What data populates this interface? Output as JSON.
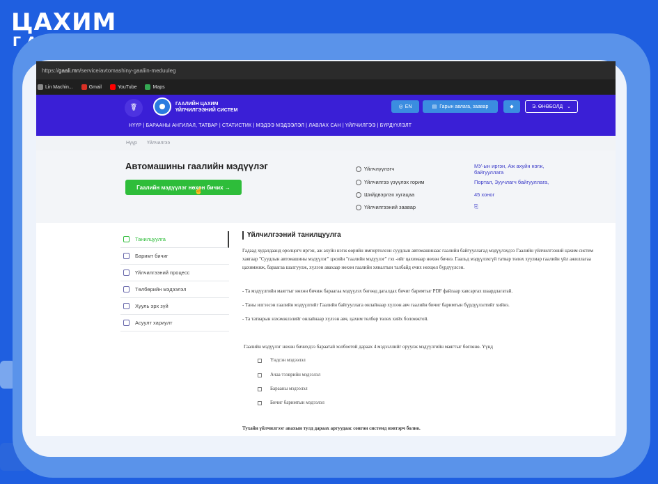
{
  "brand": {
    "line1": "ЦАХИМ",
    "line2": "ГААЛЬ"
  },
  "browser": {
    "url_prefix": "https://",
    "url_host": "gaali.mn",
    "url_path": "/service/avtomashiny-gaaliin-meduuleg",
    "bookmarks": [
      {
        "label": "Lin Machin...",
        "icon": "bookmark-icon",
        "color": "#8a8a8a"
      },
      {
        "label": "Gmail",
        "icon": "gmail-icon",
        "color": "#d93025"
      },
      {
        "label": "YouTube",
        "icon": "youtube-icon",
        "color": "#ff0000"
      },
      {
        "label": "Maps",
        "icon": "maps-icon",
        "color": "#34a853"
      }
    ]
  },
  "header": {
    "logo_text_1": "ГААЛИЙН ЦАХИМ",
    "logo_text_2": "ҮЙЛЧИЛГЭЭНИЙ СИСТЕМ",
    "lang_label": "EN",
    "guide_label": "Гарын авлага, заавар",
    "user_label": "Э. ӨНӨБОЛД",
    "nav": "НҮҮР | БАРААНЫ АНГИЛАЛ, ТАТВАР | СТАТИСТИК | МЭДЭЭ МЭДЭЭЛЭЛ | ЛАВЛАХ САН | ҮЙЛЧИЛГЭЭ | БҮРДҮҮЛЭЛТ"
  },
  "breadcrumb": {
    "home": "Нүүр",
    "current": "Үйлчилгээ"
  },
  "service": {
    "title": "Автомашины гаалийн мэдүүлэг",
    "apply_label": "Гаалийн мэдүүлэг нөхөн бичих  →",
    "info": [
      {
        "label": "Үйлчлүүлэгч",
        "value": "МУ-ын иргэн, Аж ахуйн нэгж, байгууллага"
      },
      {
        "label": "Үйлчилгээ үзүүлэх горим",
        "value": "Портал, Зуучлагч байгууллага,"
      },
      {
        "label": "Шийдвэрлэх хугацаа",
        "value": "45 хоног"
      },
      {
        "label": "Үйлчилгээний заавар",
        "value": "⎘"
      }
    ]
  },
  "sidebar": {
    "items": [
      {
        "label": "Танилцуулга",
        "active": true
      },
      {
        "label": "Баримт бичиг",
        "active": false
      },
      {
        "label": "Үйлчилгээний процесс",
        "active": false
      },
      {
        "label": "Төлбөрийн мэдээлэл",
        "active": false
      },
      {
        "label": "Хууль эрх зүй",
        "active": false
      },
      {
        "label": "Асуулт хариулт",
        "active": false
      }
    ]
  },
  "content": {
    "heading": "Үйлчилгээний танилцуулга",
    "paragraph": "Гадаад худалдаанд оролцогч иргэн, аж ахуйн нэгж өөрийн импортолсон суудлын автомашинаас гаалийн байгууллагад мэдүүлэхдээ Гаалийн үйлчилгээний цахим систем хаягаар \"Суудлын автомашины мэдүүлэг\" цэсийн \"гаалийн мэдүүлэг\" гэх -ийг цахимаар нөхөн бичнэ. Гаальд мэдүүлэхгүй татвар төлөх хуулиар гаалийн үйл ажиллагаа цахимжиж, бараагаа шалгуулж, хүлээн авахаар нөхөн гаалийн хяналтын талбайд очих нөхцөл бүрдүүлсэн.",
    "bullets": [
      "-  Та мэдүүлгийн маягтыг нөхөн бичиж бараагаа мэдүүлэх бөгөөд дагалдах бичиг баримтыг PDF файлаар хавсаргах шаардлагатай.",
      "- Таны илгээсэн гаалийн мэдүүлгийг Гаалийн байгууллага онлайнаар хүлээн авч гаалийн бичиг баримтын бүрдүүлэлтийг хийнэ.",
      "- Та татварын нэхэмжлэлийг онлайнаар хүлээн авч, цахим төлбөр төлөх хийх боломжтой."
    ],
    "note": "Гаалийн мэдүүлэг нөхөн бичихдээ бараатай холбоотой дараах 4 мэдээллийг оруулж мэдүүлгийн маягтыг бөглөнө. Үүнд",
    "list": [
      "Үндсэн мэдээлэл",
      "Ачаа тээврийн мэдээлэл",
      "Барааны мэдээлэл",
      "Бичиг баримтын мэдээлэл"
    ],
    "footer": "Тухайн үйлчилгээг авахын тулд дараах аргуудаас сонгон системд нэвтэрч болно."
  }
}
